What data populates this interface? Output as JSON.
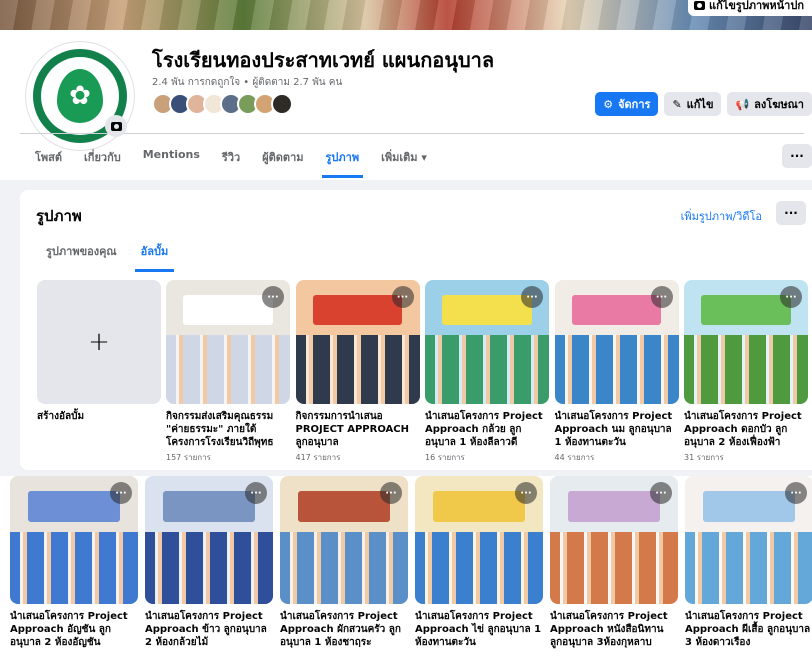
{
  "cover": {
    "edit_button_label": "แก้ไขรูปภาพหน้าปก"
  },
  "page": {
    "title": "โรงเรียนทองประสาทเวทย์ แผนกอนุบาล",
    "stats": "2.4 พัน การกดถูกใจ • ผู้ติดตาม 2.7 พัน คน",
    "follower_avatar_colors": [
      "#c9a07a",
      "#3a4f78",
      "#e0b49a",
      "#f2e6d8",
      "#5c6e8a",
      "#7a9c5a",
      "#d4a373",
      "#2e2a26"
    ]
  },
  "actions": {
    "manage_label": "จัดการ",
    "edit_label": "แก้ไข",
    "advertise_label": "ลงโฆษณา"
  },
  "tabs": [
    {
      "label": "โพสต์",
      "active": false
    },
    {
      "label": "เกี่ยวกับ",
      "active": false
    },
    {
      "label": "Mentions",
      "active": false
    },
    {
      "label": "รีวิว",
      "active": false
    },
    {
      "label": "ผู้ติดตาม",
      "active": false
    },
    {
      "label": "รูปภาพ",
      "active": true
    },
    {
      "label": "เพิ่มเติม ▾",
      "active": false
    }
  ],
  "tabs_more": "···",
  "photos": {
    "title": "รูปภาพ",
    "add_link": "เพิ่มรูปภาพ/วิดีโอ",
    "more": "···",
    "subtabs": [
      {
        "label": "รูปภาพของคุณ",
        "active": false
      },
      {
        "label": "อัลบั้ม",
        "active": true
      }
    ],
    "create_album": {
      "plus": "+",
      "label": "สร้างอัลบั้ม"
    },
    "albums_row1": [
      {
        "name": "กิจกรรมส่งเสริมคุณธรรม \"ค่ายธรรมะ\" ภายใต้โครงการโรงเรียนวิถีพุทธ",
        "count": "157 รายการ",
        "bg": "#eae6e0",
        "accent": "#ffffff",
        "kids": "#cfd6e6"
      },
      {
        "name": "กิจกรรมการนำเสนอ PROJECT APPROACH ลูกอนุบาล",
        "count": "417 รายการ",
        "bg": "#f3c7a0",
        "accent": "#d8422f",
        "kids": "#2f3a4d"
      },
      {
        "name": "นำเสนอโครงการ Project Approach กล้วย ลูกอนุบาล 1 ห้องลีลาวดี",
        "count": "16 รายการ",
        "bg": "#9bd0e8",
        "accent": "#f4e04d",
        "kids": "#3b9c6b"
      },
      {
        "name": "นำเสนอโครงการ Project Approach นม ลูกอนุบาล 1 ห้องทานตะวัน",
        "count": "44 รายการ",
        "bg": "#f1ece6",
        "accent": "#e87aa3",
        "kids": "#3a86c8"
      },
      {
        "name": "นำเสนอโครงการ Project Approach ดอกบัว ลูกอนุบาล 2 ห้องเฟื่องฟ้า",
        "count": "31 รายการ",
        "bg": "#bfe3f0",
        "accent": "#6abf5a",
        "kids": "#4f9a3f"
      }
    ],
    "albums_row2": [
      {
        "name": "นำเสนอโครงการ Project Approach อัญชัน ลูกอนุบาล 2 ห้องอัญชัน",
        "count": "",
        "bg": "#e8e3dc",
        "accent": "#6c8fd6",
        "kids": "#3f7ad0"
      },
      {
        "name": "นำเสนอโครงการ Project Approach ข้าว ลูกอนุบาล 2 ห้องกล้วยไม้",
        "count": "",
        "bg": "#d9e2ee",
        "accent": "#7a95c2",
        "kids": "#2f4f9a"
      },
      {
        "name": "นำเสนอโครงการ Project Approach ผักสวนครัว ลูกอนุบาล 1 ห้องชาฤระ",
        "count": "",
        "bg": "#efe0c8",
        "accent": "#b8543a",
        "kids": "#5a8fc8"
      },
      {
        "name": "นำเสนอโครงการ Project Approach ไข่ ลูกอนุบาล 1 ห้องทานตะวัน",
        "count": "",
        "bg": "#f3e7c2",
        "accent": "#f0c84a",
        "kids": "#3b7fcf"
      },
      {
        "name": "นำเสนอโครงการ Project Approach หนังสือนิทาน ลูกอนุบาล 3ห้องกุหลาบ",
        "count": "",
        "bg": "#e6ebf0",
        "accent": "#c7a9d4",
        "kids": "#d47a4a"
      },
      {
        "name": "นำเสนอโครงการ Project Approach ผีเสื้อ ลูกอนุบาล 3 ห้องดาวเรือง",
        "count": "",
        "bg": "#f4f1ee",
        "accent": "#a1c8e8",
        "kids": "#63a8d8"
      }
    ]
  }
}
